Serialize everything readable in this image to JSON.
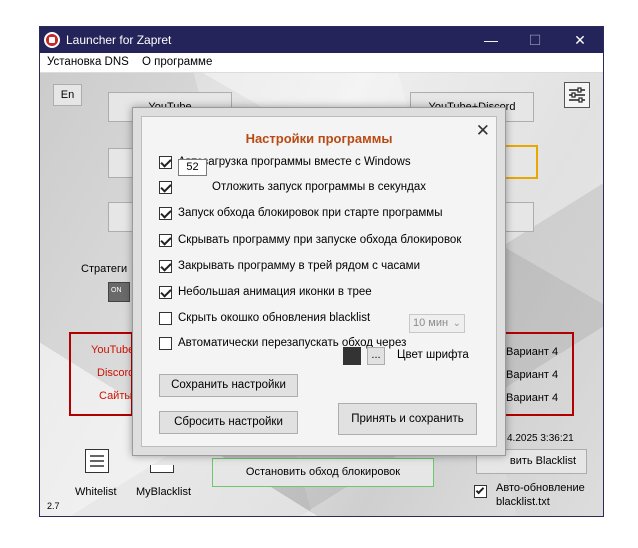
{
  "window": {
    "title": "Launcher for Zapret",
    "controls": {
      "minimize": "—",
      "maximize": "☐",
      "close": "✕"
    }
  },
  "menu": {
    "items": [
      "Установка DNS",
      "О программе"
    ]
  },
  "main": {
    "lang_button": "En",
    "top_left_button": "YouTube",
    "top_right_button": "YouTube+Discord",
    "strategy_label": "Стратеги",
    "toggle_label": "ON",
    "sites": [
      "YouTube",
      "Discord",
      "Сайты"
    ],
    "variants": [
      "Вариант 4",
      "Вариант 4",
      "Вариант 4"
    ],
    "date_text": "4.2025 3:36:21",
    "stop_button": "Остановить обход блокировок",
    "update_blacklist_button": "вить Blacklist",
    "auto_update_label_line1": "Авто-обновление",
    "auto_update_label_line2": "blacklist.txt",
    "whitelist_label": "Whitelist",
    "myblacklist_label": "MyBlacklist",
    "version": "2.7"
  },
  "dialog": {
    "title": "Настройки программы",
    "close_icon": "✕",
    "options": [
      {
        "label": "Автозагрузка программы вместе с Windows",
        "checked": true
      },
      {
        "label": "Отложить запуск программы в секундах",
        "checked": true,
        "value": "52"
      },
      {
        "label": "Запуск обхода блокировок при старте программы",
        "checked": true
      },
      {
        "label": "Скрывать программу при запуске обхода блокировок",
        "checked": true
      },
      {
        "label": "Закрывать программу в трей рядом с часами",
        "checked": true
      },
      {
        "label": "Небольшая анимация иконки в трее",
        "checked": true
      },
      {
        "label": "Скрыть окошко обновления blacklist",
        "checked": false
      },
      {
        "label": "Автоматически перезапускать обход через",
        "checked": false,
        "interval": "10 мин"
      }
    ],
    "save_button": "Сохранить настройки",
    "reset_button": "Сбросить настройки",
    "apply_button": "Принять и сохранить",
    "color_dots": "...",
    "font_color_label": "Цвет шрифта",
    "font_color": "#333333"
  }
}
